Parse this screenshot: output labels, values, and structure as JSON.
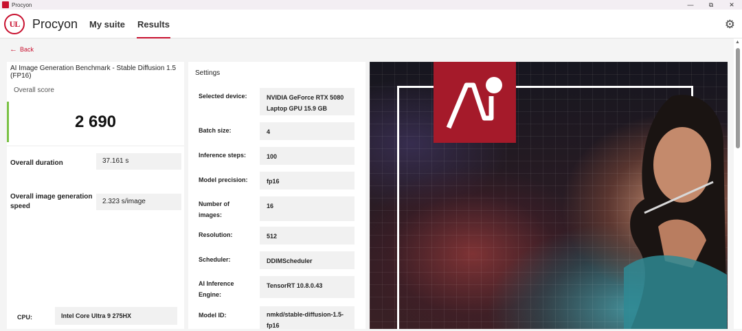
{
  "window": {
    "title": "Procyon",
    "minimize_glyph": "—",
    "maximize_glyph": "⧉",
    "close_glyph": "✕"
  },
  "header": {
    "logo_text": "UL",
    "brand": "Procyon",
    "tabs": [
      {
        "label": "My suite",
        "active": false
      },
      {
        "label": "Results",
        "active": true
      }
    ],
    "settings_icon": "gear-icon"
  },
  "back": {
    "label": "Back",
    "icon": "arrow-left-icon"
  },
  "result": {
    "benchmark_title": "AI Image Generation Benchmark - Stable Diffusion 1.5 (FP16)",
    "overall_score_label": "Overall score",
    "overall_score": "2 690",
    "metrics": [
      {
        "label": "Overall duration",
        "value": "37.161 s"
      },
      {
        "label": "Overall image generation speed",
        "value": "2.323 s/image"
      }
    ],
    "cpu": {
      "label": "CPU:",
      "value": "Intel Core Ultra 9 275HX"
    }
  },
  "settings": {
    "title": "Settings",
    "rows": [
      {
        "label": "Selected device:",
        "value": "NVIDIA GeForce RTX 5080 Laptop GPU 15.9 GB"
      },
      {
        "label": "Batch size:",
        "value": "4"
      },
      {
        "label": "Inference steps:",
        "value": "100"
      },
      {
        "label": "Model precision:",
        "value": "fp16"
      },
      {
        "label": "Number of images:",
        "value": "16"
      },
      {
        "label": "Resolution:",
        "value": "512"
      },
      {
        "label": "Scheduler:",
        "value": "DDIMScheduler"
      },
      {
        "label": "AI Inference Engine:",
        "value": "TensorRT 10.8.0.43"
      },
      {
        "label": "Model ID:",
        "value": "nmkd/stable-diffusion-1.5-fp16"
      }
    ]
  },
  "colors": {
    "accent": "#c8102e",
    "score_bar": "#7ac143",
    "ai_logo_bg": "#a51a2a"
  }
}
